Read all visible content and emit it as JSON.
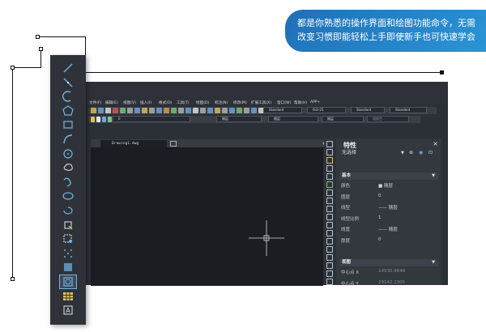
{
  "caption": {
    "line1": "都是你熟悉的操作界面和绘图功能命令，无需",
    "line2": "改变习惯即能轻松上手即使新手也可快速学会"
  },
  "menu": [
    {
      "label": "文件(F)",
      "icon": "file"
    },
    {
      "label": "编辑(E)",
      "icon": "edit"
    },
    {
      "label": "视图(V)",
      "icon": "view"
    },
    {
      "label": "插入(I)",
      "icon": "insert"
    },
    {
      "label": "格式(O)",
      "icon": "format"
    },
    {
      "label": "工具(T)",
      "icon": "tools"
    },
    {
      "label": "绘图(D)",
      "icon": "draw"
    },
    {
      "label": "标注(N)",
      "icon": "dimension"
    },
    {
      "label": "修改(M)",
      "icon": "modify"
    },
    {
      "label": "扩展工具(X)",
      "icon": "express"
    },
    {
      "label": "窗口(W)",
      "icon": "window"
    },
    {
      "label": "帮助(H)",
      "icon": "help"
    },
    {
      "label": "APP+",
      "icon": "app"
    }
  ],
  "toolbar": {
    "text_style": "Standard",
    "dim_style": "ISO-25",
    "table_style": "Standard",
    "multileader_style": "Standard",
    "layer_value": "0",
    "color_value": "随层",
    "linetype_value": "随层",
    "lineweight_value": "随层",
    "plot_style": "随颜色"
  },
  "document": {
    "tab_label": "Drawing1.dwg"
  },
  "properties": {
    "title": "特性",
    "close_glyph": "×",
    "selection": "无选择",
    "sections": {
      "basic": "基本",
      "view": "视图"
    },
    "basic_rows": [
      {
        "label": "颜色",
        "value": "■ 随层"
      },
      {
        "label": "图层",
        "value": "0"
      },
      {
        "label": "线型",
        "value": "—— 随层"
      },
      {
        "label": "线型比例",
        "value": "1"
      },
      {
        "label": "线宽",
        "value": "—— 随层"
      },
      {
        "label": "厚度",
        "value": "0"
      }
    ],
    "view_rows": [
      {
        "label": "中心点 X",
        "value": "14930.9648"
      },
      {
        "label": "中心点 Y",
        "value": "29142.2305"
      }
    ]
  },
  "palette_tools": [
    "line-icon",
    "polyline-icon",
    "arc-icon",
    "polygon-icon",
    "rectangle-icon",
    "spline-arc-icon",
    "circle-icon",
    "revision-cloud-icon",
    "spline-icon",
    "ellipse-icon",
    "ellipse-arc-icon",
    "insert-block-icon",
    "make-block-icon",
    "point-icon",
    "hatch-icon",
    "region-icon",
    "table-icon",
    "mtext-icon"
  ],
  "colors": {
    "app_bg": "#2b2f36",
    "canvas": "#1b1d22",
    "accent": "#2b95d6",
    "palette_bg": "#2f3339"
  }
}
